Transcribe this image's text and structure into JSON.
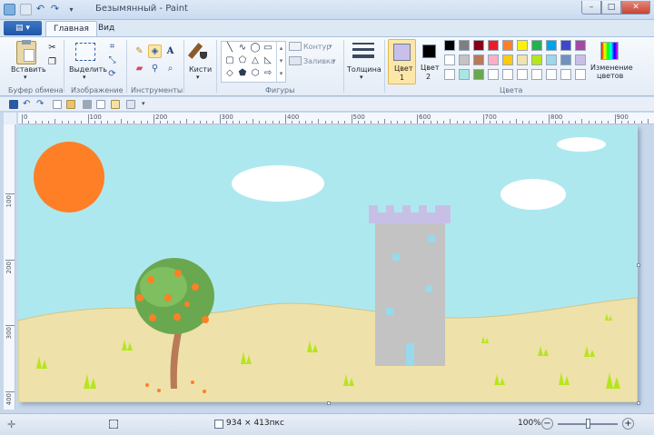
{
  "window": {
    "title": "Безымянный - Paint",
    "minimize_symbol": "–",
    "maximize_symbol": "□",
    "close_symbol": "✕"
  },
  "tabs": {
    "file_label": "▤ ▾",
    "home": "Главная",
    "view": "Вид"
  },
  "ribbon": {
    "clipboard": {
      "paste": "Вставить",
      "group": "Буфер обмена"
    },
    "image": {
      "select": "Выделить",
      "group": "Изображение"
    },
    "tools": {
      "group": "Инструменты",
      "text_tool": "A"
    },
    "brushes": {
      "label": "Кисти"
    },
    "shapes": {
      "outline": "Контур",
      "fill": "Заливка",
      "group": "Фигуры"
    },
    "size": {
      "label": "Толщина"
    },
    "colors": {
      "color1_label": "Цвет",
      "color1_num": "1",
      "color2_label": "Цвет",
      "color2_num": "2",
      "edit_label_1": "Изменение",
      "edit_label_2": "цветов",
      "group": "Цвета",
      "color1_value": "#c8c0e8",
      "color2_value": "#000000",
      "palette_row1": [
        "#000000",
        "#7f7f7f",
        "#880015",
        "#ed1c24",
        "#ff7f27",
        "#fff200",
        "#22b14c",
        "#00a2e8",
        "#3f48cc",
        "#a349a4"
      ],
      "palette_row2": [
        "#ffffff",
        "#c3c3c3",
        "#b97a57",
        "#ffaec9",
        "#ffc90e",
        "#efe4b0",
        "#b5e61d",
        "#99d9ea",
        "#7092be",
        "#c8bfe7"
      ],
      "palette_row3": [
        "#ffffff",
        "#a8e6e6",
        "#6aa84f",
        "#ffffff",
        "#ffffff",
        "#ffffff",
        "#ffffff",
        "#ffffff",
        "#ffffff",
        "#ffffff"
      ]
    }
  },
  "ruler": {
    "h_labels": [
      "0",
      "100",
      "200",
      "300",
      "400",
      "500",
      "600",
      "700",
      "800",
      "900"
    ],
    "v_labels": [
      "100",
      "200",
      "300",
      "400"
    ]
  },
  "statusbar": {
    "dimensions": "934 × 413пкс",
    "zoom": "100%",
    "zoom_out": "−",
    "zoom_in": "+",
    "zoom_level": 1.0
  }
}
